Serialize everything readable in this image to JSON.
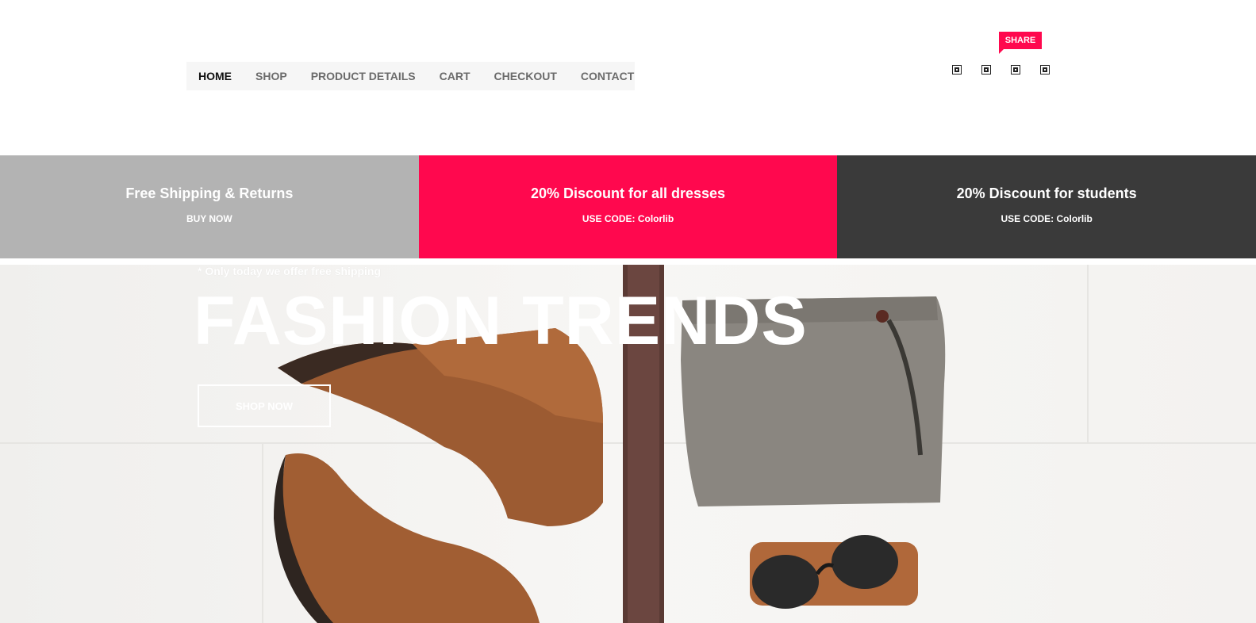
{
  "nav": {
    "items": [
      {
        "label": "HOME",
        "active": true
      },
      {
        "label": "SHOP"
      },
      {
        "label": "PRODUCT DETAILS"
      },
      {
        "label": "CART"
      },
      {
        "label": "CHECKOUT"
      },
      {
        "label": "CONTACT"
      }
    ]
  },
  "share": {
    "label": "SHARE",
    "icons": [
      "pinterest-icon",
      "facebook-icon",
      "twitter-icon",
      "linkedin-icon"
    ]
  },
  "promos": [
    {
      "title": "Free Shipping & Returns",
      "subtitle": "BUY NOW",
      "color": "#b3b3b3"
    },
    {
      "title": "20% Discount for all dresses",
      "subtitle": "USE CODE: Colorlib",
      "color": "#ff084e"
    },
    {
      "title": "20% Discount for students",
      "subtitle": "USE CODE: Colorlib",
      "color": "#3a3a3a"
    }
  ],
  "hero": {
    "eyebrow": "* Only today we offer free shipping",
    "title": "FASHION TRENDS",
    "button_label": "SHOP NOW"
  },
  "colors": {
    "accent": "#ff084e",
    "dark": "#3a3a3a",
    "grey": "#b3b3b3"
  }
}
